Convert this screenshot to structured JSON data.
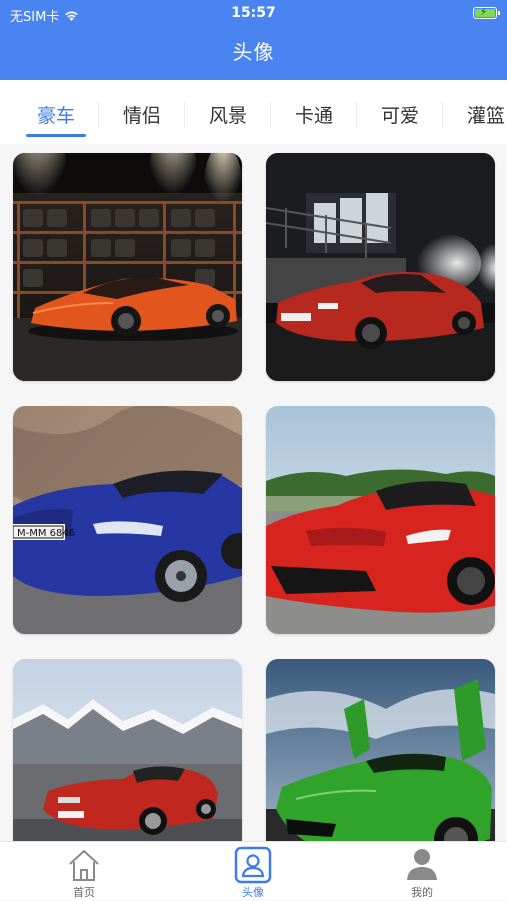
{
  "status_bar": {
    "carrier": "无SIM卡",
    "time": "15:57"
  },
  "nav": {
    "title": "头像"
  },
  "tabs": [
    {
      "label": "豪车",
      "active": true
    },
    {
      "label": "情侣",
      "active": false
    },
    {
      "label": "风景",
      "active": false
    },
    {
      "label": "卡通",
      "active": false
    },
    {
      "label": "可爱",
      "active": false
    },
    {
      "label": "灌篮",
      "active": false
    }
  ],
  "grid": {
    "items": [
      {
        "subject": "orange-supercar-garage",
        "plate": ""
      },
      {
        "subject": "red-coupe-night",
        "plate": ""
      },
      {
        "subject": "blue-convertible",
        "plate": "M-MM 6846"
      },
      {
        "subject": "red-hypercar",
        "plate": ""
      },
      {
        "subject": "red-roadster-mountains",
        "plate": ""
      },
      {
        "subject": "green-supercar-doors-up",
        "plate": ""
      }
    ]
  },
  "bottom_nav": [
    {
      "label": "首页",
      "icon": "home-icon",
      "active": false
    },
    {
      "label": "头像",
      "icon": "avatar-icon",
      "active": true
    },
    {
      "label": "我的",
      "icon": "user-icon",
      "active": false
    }
  ],
  "colors": {
    "primary": "#4a84f0",
    "accent": "#3e7be8",
    "tab_inactive": "#333333"
  }
}
